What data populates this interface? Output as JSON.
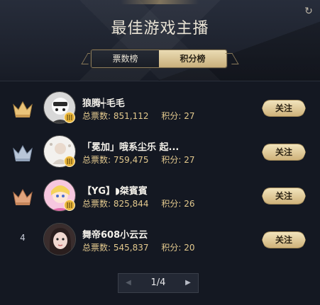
{
  "header": {
    "title": "最佳游戏主播",
    "refresh_icon": "refresh-icon"
  },
  "tabs": [
    {
      "label": "票数榜",
      "active": false
    },
    {
      "label": "积分榜",
      "active": true
    }
  ],
  "labels": {
    "total_votes": "总票数:",
    "points": "积分:",
    "follow": "关注"
  },
  "rows": [
    {
      "rank": "1",
      "rank_style": "crown-gold",
      "name": "狼腾┽毛毛",
      "votes": "851,112",
      "points": "27"
    },
    {
      "rank": "2",
      "rank_style": "crown-silver",
      "name": "「冕加」哦系尘乐 起...",
      "votes": "759,475",
      "points": "27"
    },
    {
      "rank": "3",
      "rank_style": "crown-bronze",
      "name": "【YG】◗桀賓賓",
      "votes": "825,844",
      "points": "26"
    },
    {
      "rank": "4",
      "rank_style": "plain",
      "name": "舞帝608小云云",
      "votes": "545,837",
      "points": "20"
    }
  ],
  "pager": {
    "text": "1/4"
  },
  "colors": {
    "gold_accent": "#e3c98e",
    "button_gold": "#cfb27a"
  }
}
